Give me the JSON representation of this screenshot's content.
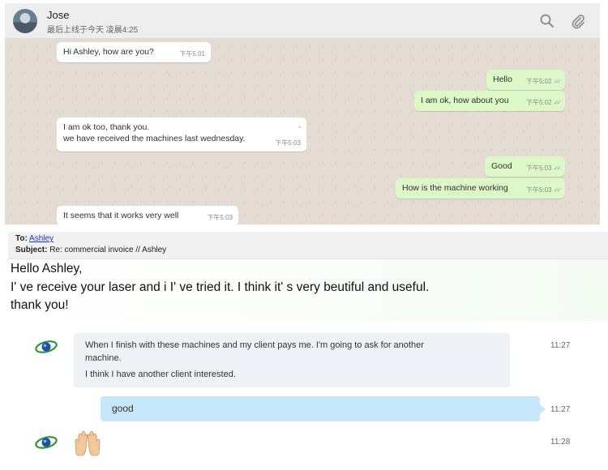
{
  "whatsapp": {
    "contact_name": "Jose",
    "last_seen": "最后上线于今天 凌晨4:25",
    "icons": [
      "search-icon",
      "paperclip-icon"
    ],
    "messages": [
      {
        "direction": "in",
        "lines": [
          "Hi Ashley, how are you?"
        ],
        "time": "下午5:01"
      },
      {
        "direction": "out",
        "lines": [
          "Hello"
        ],
        "time": "下午5:02",
        "status": "✓✓"
      },
      {
        "direction": "out",
        "lines": [
          "I am ok, how about you"
        ],
        "time": "下午5:02",
        "status": "✓✓"
      },
      {
        "direction": "in",
        "lines": [
          "I am ok too, thank you.",
          "we have received the machines last wednesday."
        ],
        "time": "下午5:03"
      },
      {
        "direction": "out",
        "lines": [
          "Good"
        ],
        "time": "下午5:03",
        "status": "✓✓"
      },
      {
        "direction": "out",
        "lines": [
          "How is the machine working"
        ],
        "time": "下午5:03",
        "status": "✓✓"
      },
      {
        "direction": "in",
        "lines": [
          "It seems that it works very well"
        ],
        "time": "下午5:03"
      }
    ],
    "colors": {
      "incoming": "#ffffff",
      "outgoing": "#dcf8c6",
      "background": "#e4dcd2"
    }
  },
  "email": {
    "to_label": "To:",
    "to_value": "Ashley",
    "subject_label": "Subject:",
    "subject_value": "Re: commercial invoice // Ashley",
    "body": [
      "Hello Ashley,",
      "I' ve receive your laser and i I' ve tried it. I think it' s very beutiful and useful.",
      "thank you!"
    ]
  },
  "skype": {
    "messages": [
      {
        "direction": "in",
        "lines": [
          "When I finish with these machines and my client pays me. I'm going to ask for another",
          "machine.",
          "I think I have another client interested."
        ],
        "time": "11:27"
      },
      {
        "direction": "out",
        "text": "good",
        "time": "11:27"
      },
      {
        "direction": "in",
        "emoji": "raising-hands",
        "time": "11:28"
      }
    ],
    "colors": {
      "incoming": "#eef1f6",
      "outgoing": "#c7e7fa"
    }
  }
}
